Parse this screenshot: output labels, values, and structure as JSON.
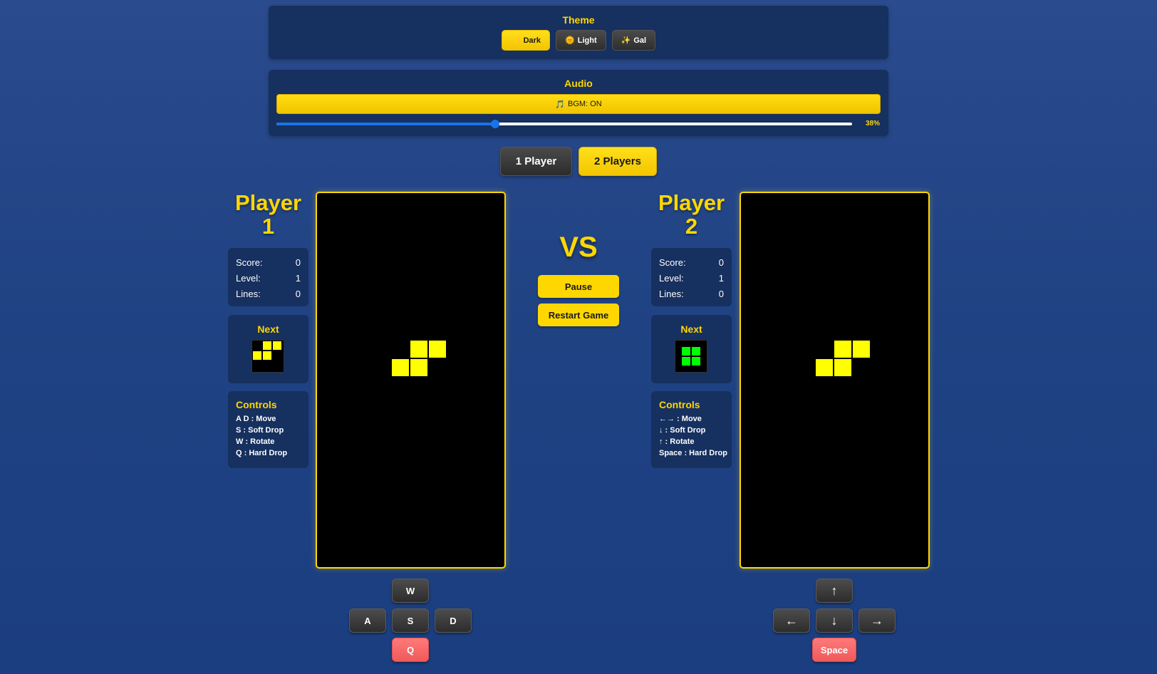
{
  "theme": {
    "title": "Theme",
    "options": [
      {
        "icon": "🌙",
        "label": "Dark",
        "active": true
      },
      {
        "icon": "🌞",
        "label": "Light",
        "active": false
      },
      {
        "icon": "✨",
        "label": "Gal",
        "active": false
      }
    ]
  },
  "audio": {
    "title": "Audio",
    "bgm_icon": "🎵",
    "bgm_label": "BGM: ON",
    "volume_percent": 38,
    "volume_label": "38%"
  },
  "mode": {
    "one_player": "1 Player",
    "two_players": "2 Players",
    "selected": "2 Players"
  },
  "vs_label": "VS",
  "buttons": {
    "pause": "Pause",
    "restart": "Restart Game"
  },
  "player1": {
    "title_line1": "Player",
    "title_line2": "1",
    "stats": {
      "score_label": "Score:",
      "score": "0",
      "level_label": "Level:",
      "level": "1",
      "lines_label": "Lines:",
      "lines": "0"
    },
    "next_label": "Next",
    "next_piece": "S",
    "next_color": "#ffff00",
    "controls_title": "Controls",
    "controls": [
      "A D : Move",
      "S : Soft Drop",
      "W : Rotate",
      "Q : Hard Drop"
    ],
    "active_piece": "S",
    "active_color": "#ffff00",
    "keys": {
      "up": "W",
      "left": "A",
      "down": "S",
      "right": "D",
      "drop": "Q"
    }
  },
  "player2": {
    "title_line1": "Player",
    "title_line2": "2",
    "stats": {
      "score_label": "Score:",
      "score": "0",
      "level_label": "Level:",
      "level": "1",
      "lines_label": "Lines:",
      "lines": "0"
    },
    "next_label": "Next",
    "next_piece": "O",
    "next_color": "#00ff00",
    "controls_title": "Controls",
    "controls": [
      "←→ : Move",
      "↓ : Soft Drop",
      "↑ : Rotate",
      "Space : Hard Drop"
    ],
    "active_piece": "S",
    "active_color": "#ffff00",
    "keys": {
      "up": "↑",
      "left": "←",
      "down": "↓",
      "right": "→",
      "drop": "Space"
    }
  }
}
